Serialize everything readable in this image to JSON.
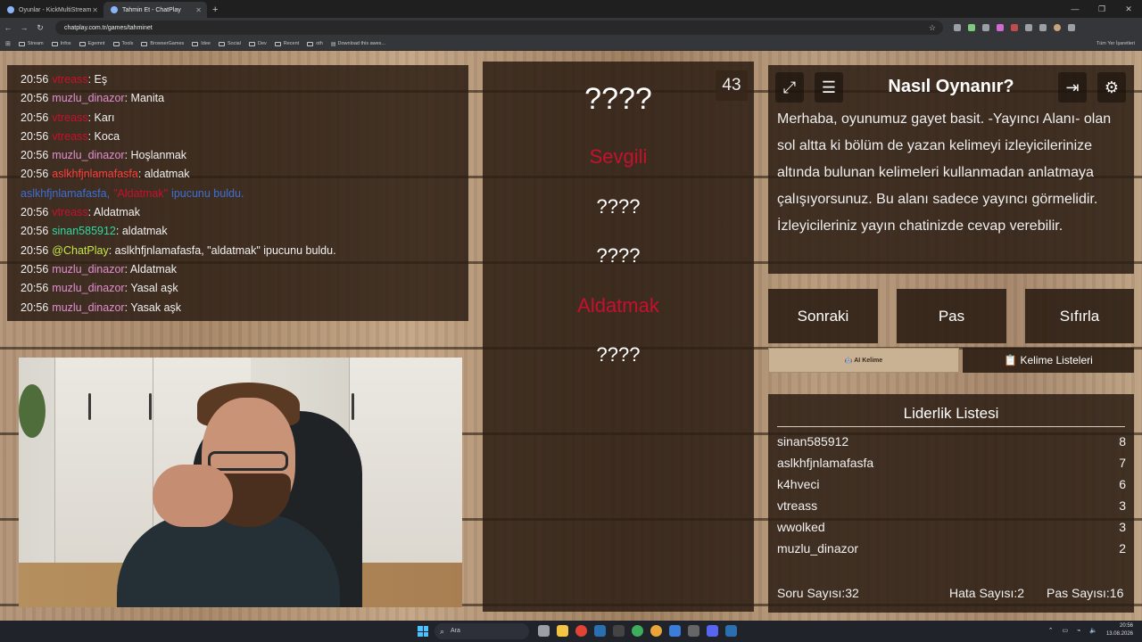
{
  "browser": {
    "tabs": [
      {
        "label": "Oyunlar - KickMultiStream",
        "active": false
      },
      {
        "label": "Tahmin Et - ChatPlay",
        "active": true
      }
    ],
    "url": "chatplay.com.tr/games/tahminet",
    "bookmarks": [
      "Stream",
      "Infos",
      "Egemnt",
      "Tools",
      "BrowserGames",
      "Idee",
      "Social",
      "Dev",
      "Recent",
      "oth",
      "Download this awes..."
    ],
    "bookmarks_right": "Tüm Yer İşaretleri"
  },
  "chat": {
    "messages": [
      {
        "time": "20:56",
        "user": "vtreass",
        "text": "Eş",
        "color": "#c8102e"
      },
      {
        "time": "20:56",
        "user": "muzlu_dinazor",
        "text": "Manita",
        "color": "#e08fd0"
      },
      {
        "time": "20:56",
        "user": "vtreass",
        "text": "Karı",
        "color": "#c8102e"
      },
      {
        "time": "20:56",
        "user": "vtreass",
        "text": "Koca",
        "color": "#c8102e"
      },
      {
        "time": "20:56",
        "user": "muzlu_dinazor",
        "text": "Hoşlanmak",
        "color": "#e08fd0"
      },
      {
        "time": "20:56",
        "user": "aslkhfjnlamafasfa",
        "text": "aldatmak",
        "color": "#ff3d3d"
      },
      {
        "system": true,
        "user": "aslkhfjnlamafasfa,",
        "word": "\"Aldatmak\"",
        "text": "ipucunu buldu.",
        "color": "#3b6fd6"
      },
      {
        "time": "20:56",
        "user": "vtreass",
        "text": "Aldatmak",
        "color": "#c8102e"
      },
      {
        "time": "20:56",
        "user": "sinan585912",
        "text": "aldatmak",
        "color": "#2fd8a0"
      },
      {
        "time": "20:56",
        "user": "@ChatPlay",
        "text": "aslkhfjnlamafasfa, \"aldatmak\" ipucunu buldu.",
        "color": "#c6e64a"
      },
      {
        "time": "20:56",
        "user": "muzlu_dinazor",
        "text": "Aldatmak",
        "color": "#e08fd0"
      },
      {
        "time": "20:56",
        "user": "muzlu_dinazor",
        "text": "Yasal aşk",
        "color": "#e08fd0"
      },
      {
        "time": "20:56",
        "user": "muzlu_dinazor",
        "text": "Yasak aşk",
        "color": "#e08fd0"
      }
    ]
  },
  "game": {
    "counter": "43",
    "words": [
      {
        "text": "????",
        "revealed": false,
        "main": true
      },
      {
        "text": "Sevgili",
        "revealed": true
      },
      {
        "text": "????",
        "revealed": false
      },
      {
        "text": "????",
        "revealed": false
      },
      {
        "text": "Aldatmak",
        "revealed": true
      },
      {
        "text": "????",
        "revealed": false
      }
    ]
  },
  "info": {
    "title": "Nasıl Oynanır?",
    "description": "Merhaba, oyunumuz gayet basit. -Yayıncı Alanı- olan sol altta ki bölüm de yazan kelimeyi izleyicilerinize altında bulunan kelimeleri kullanmadan anlatmaya çalışıyorsunuz. Bu alanı sadece yayıncı görmelidir. İzleyicileriniz yayın chatinizde cevap verebilir."
  },
  "controls": {
    "next": "Sonraki",
    "pass": "Pas",
    "reset": "Sıfırla"
  },
  "tabs": {
    "ai": "🤖 AI Kelime",
    "lists": "📋 Kelime Listeleri"
  },
  "leaderboard": {
    "title": "Liderlik Listesi",
    "rows": [
      {
        "name": "sinan585912",
        "score": "8"
      },
      {
        "name": "aslkhfjnlamafasfa",
        "score": "7"
      },
      {
        "name": "k4hveci",
        "score": "6"
      },
      {
        "name": "vtreass",
        "score": "3"
      },
      {
        "name": "wwolked",
        "score": "3"
      },
      {
        "name": "muzlu_dinazor",
        "score": "2"
      }
    ],
    "questions": "Soru Sayısı:32",
    "errors": "Hata Sayısı:2",
    "passes": "Pas Sayısı:16"
  },
  "taskbar": {
    "search": "Ara",
    "time": "20:56",
    "date": "13.08.2026"
  }
}
